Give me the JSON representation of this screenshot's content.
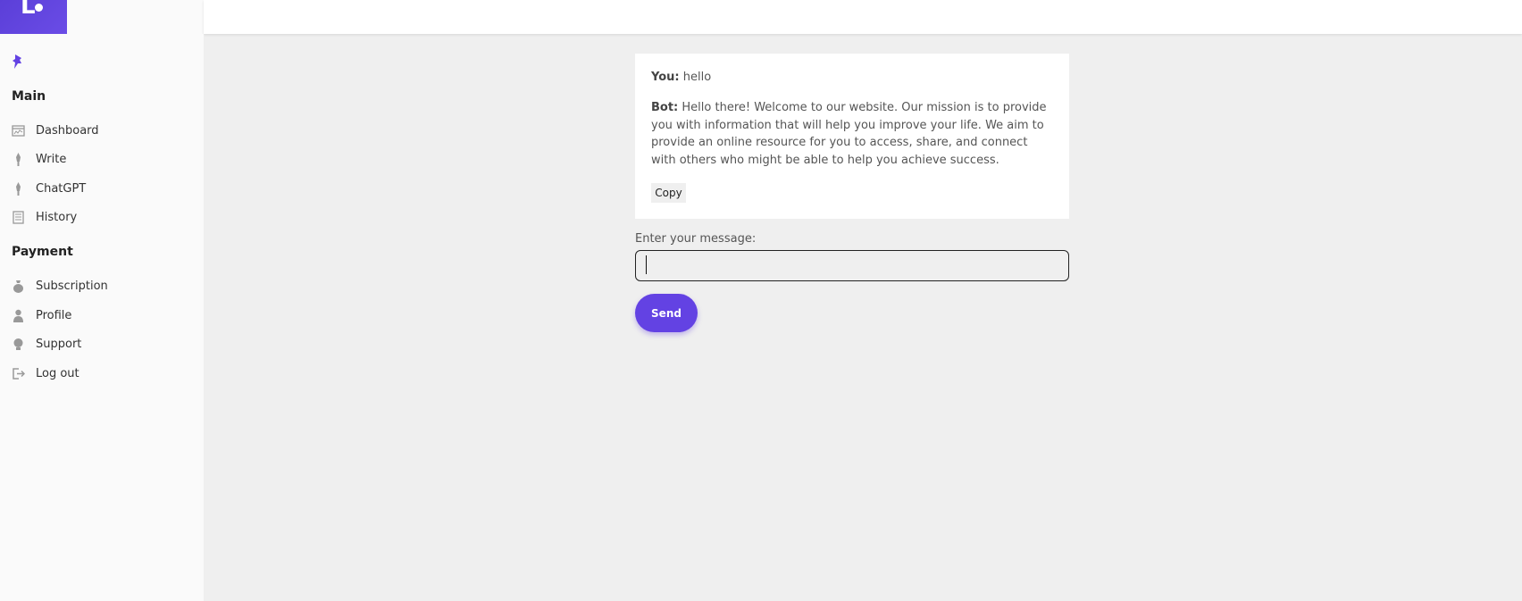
{
  "sidebar": {
    "sections": [
      {
        "title": "Main",
        "items": [
          {
            "label": "Dashboard",
            "icon": "dashboard-icon"
          },
          {
            "label": "Write",
            "icon": "pen-icon"
          },
          {
            "label": "ChatGPT",
            "icon": "pen-icon"
          },
          {
            "label": "History",
            "icon": "history-icon"
          }
        ]
      },
      {
        "title": "Payment",
        "items": [
          {
            "label": "Subscription",
            "icon": "money-bag-icon"
          },
          {
            "label": "Profile",
            "icon": "user-icon"
          },
          {
            "label": "Support",
            "icon": "support-icon"
          },
          {
            "label": "Log out",
            "icon": "logout-icon"
          }
        ]
      }
    ]
  },
  "chat": {
    "messages": [
      {
        "speaker": "You:",
        "text": " hello"
      },
      {
        "speaker": "Bot:",
        "text": " Hello there! Welcome to our website. Our mission is to provide you with information that will help you improve your life. We aim to provide an online resource for you to access, share, and connect with others who might be able to help you achieve success."
      }
    ],
    "copy_label": "Copy"
  },
  "composer": {
    "label": "Enter your message:",
    "value": "",
    "send_label": "Send"
  },
  "colors": {
    "accent": "#6342e3",
    "content_bg": "#efefef",
    "sidebar_bg": "#fafafa"
  }
}
